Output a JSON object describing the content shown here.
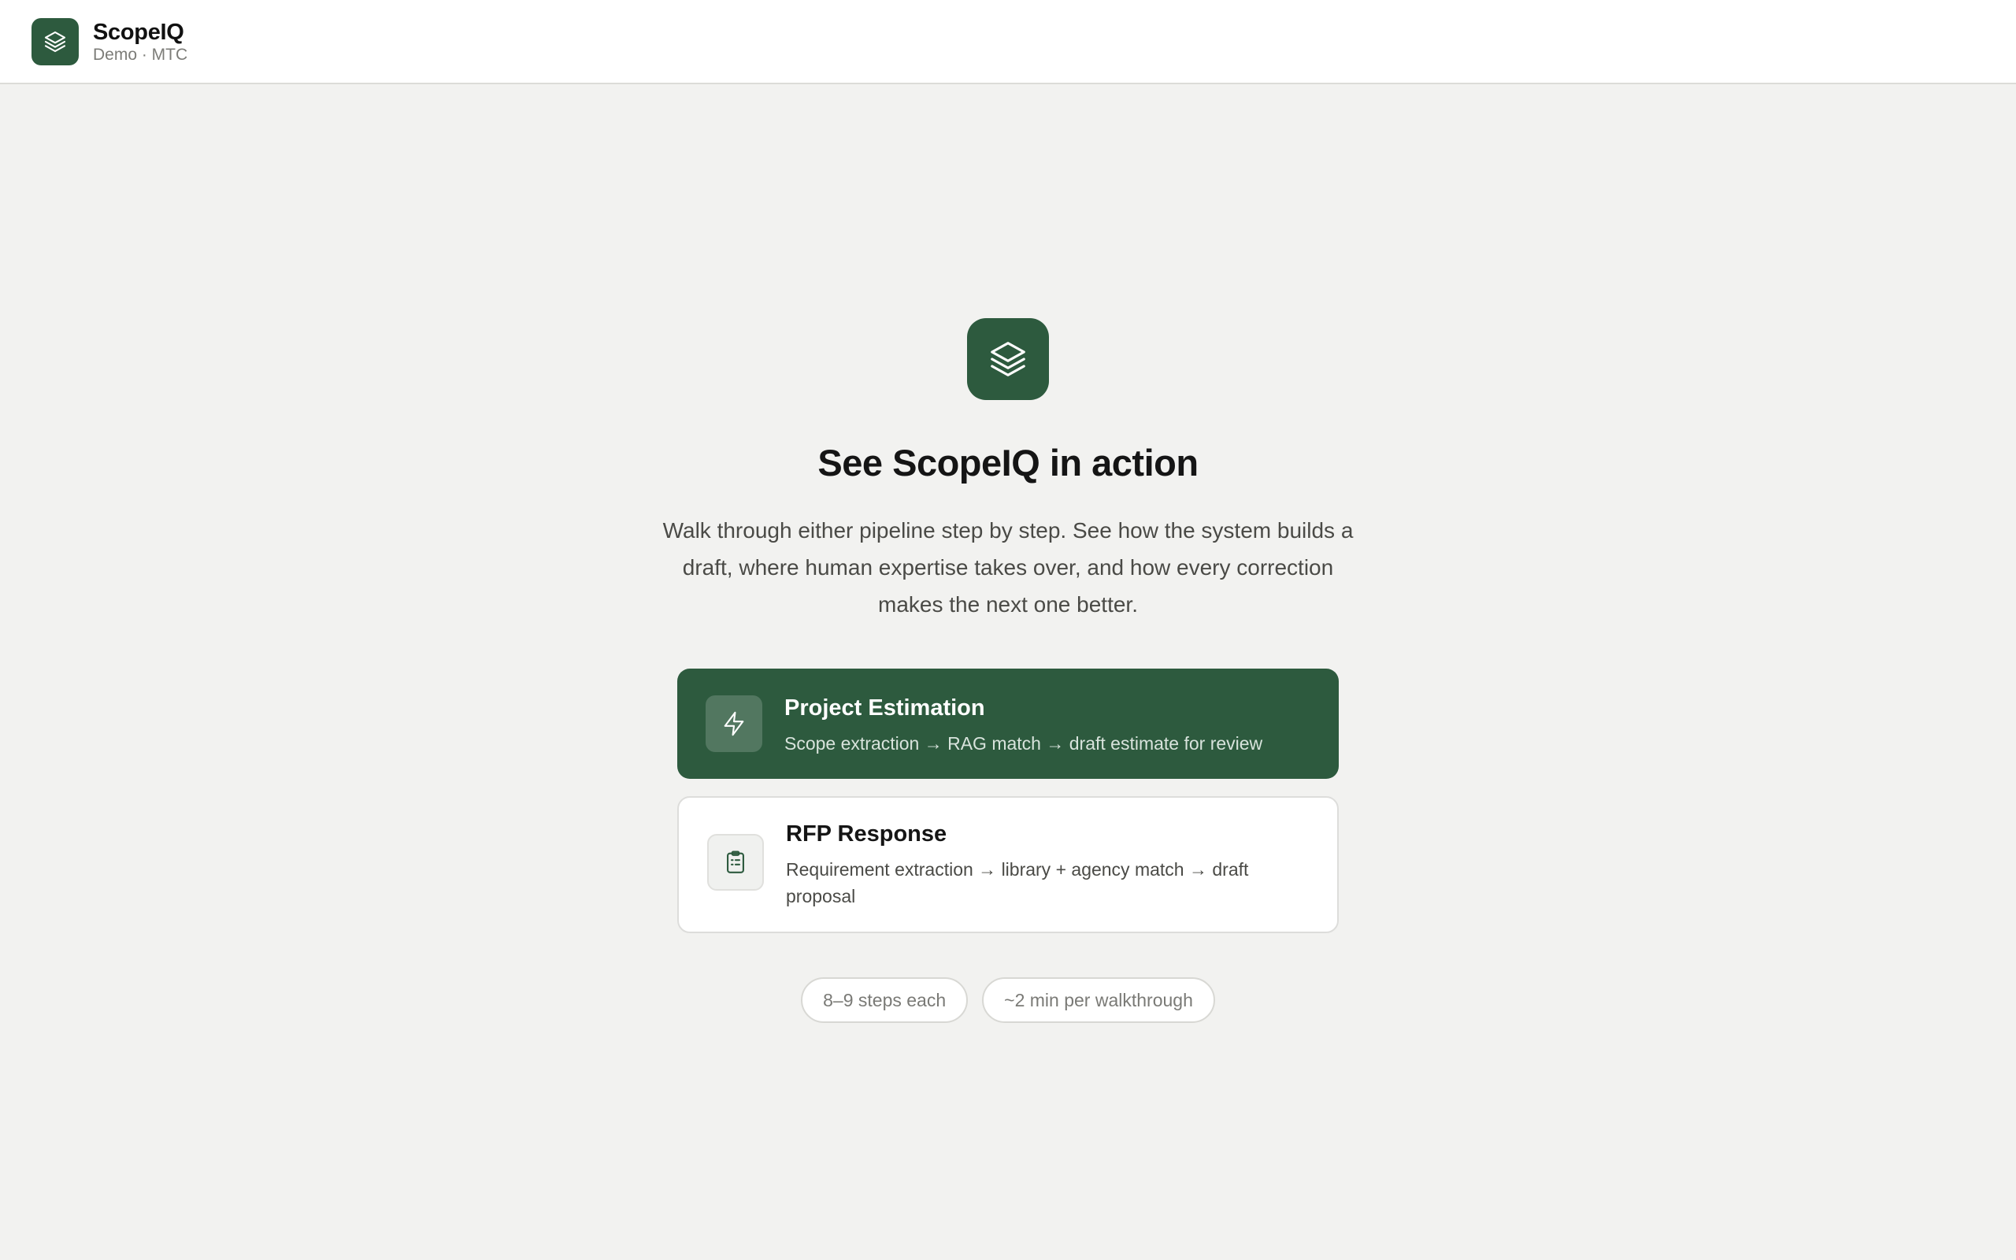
{
  "header": {
    "brand_name": "ScopeIQ",
    "brand_sub": "Demo · MTC",
    "logo_icon": "layers-icon"
  },
  "hero": {
    "icon": "layers-icon",
    "title": "See ScopeIQ in action",
    "subtitle": "Walk through either pipeline step by step. See how the system builds a draft, where human expertise takes over, and how every correction makes the next one better."
  },
  "cards": [
    {
      "icon": "lightning-icon",
      "title": "Project Estimation",
      "description": "Scope extraction → RAG match → draft estimate for review",
      "selected": true
    },
    {
      "icon": "clipboard-list-icon",
      "title": "RFP Response",
      "description": "Requirement extraction → library + agency match → draft proposal",
      "selected": false
    }
  ],
  "pills": [
    "8–9 steps each",
    "~2 min per walkthrough"
  ],
  "colors": {
    "accent": "#2d5a3e",
    "background": "#f2f2f0",
    "surface": "#ffffff"
  }
}
